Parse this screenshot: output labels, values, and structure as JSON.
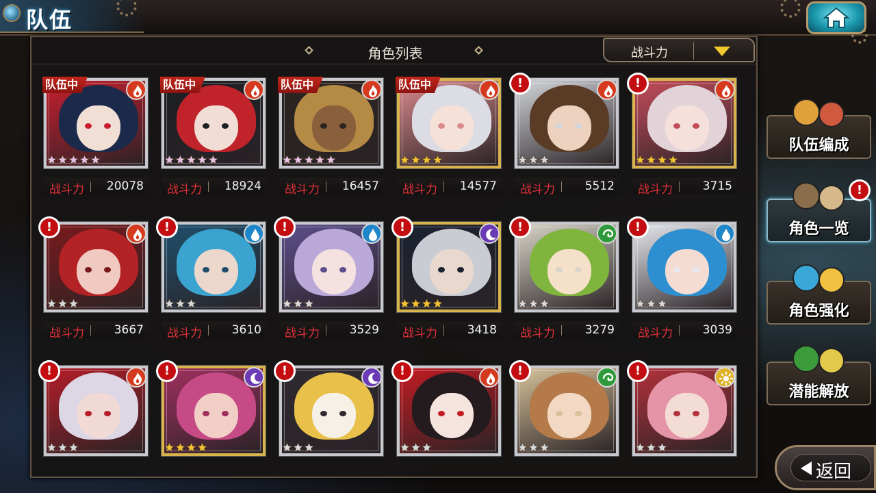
{
  "header": {
    "title": "队伍"
  },
  "panel": {
    "title": "角色列表",
    "sort": {
      "selected": "战斗力"
    },
    "power_label": "战斗力"
  },
  "colors": {
    "fire": "#d63a1e",
    "water": "#1f86c9",
    "dark": "#6b3bb5",
    "wind": "#2e9a3a",
    "light": "#e0b227",
    "badge_red": "#c2261b",
    "power_label": "#e0323a"
  },
  "cards": [
    {
      "badge": "队伍中",
      "element": "fire-icon",
      "rarity": 5,
      "power": "20078",
      "alert": false,
      "palette": [
        "#1b2a4a",
        "#f1dfd6",
        "#c81e2e"
      ]
    },
    {
      "badge": "队伍中",
      "element": "fire-icon",
      "rarity": 5,
      "power": "18924",
      "alert": false,
      "palette": [
        "#c0232a",
        "#f2ddd6",
        "#1c1f24"
      ]
    },
    {
      "badge": "队伍中",
      "element": "fire-icon",
      "rarity": 5,
      "power": "16457",
      "alert": false,
      "palette": [
        "#b58a45",
        "#8a5f3c",
        "#2b2420"
      ]
    },
    {
      "badge": "队伍中",
      "element": "fire-icon",
      "rarity": 4,
      "power": "14577",
      "alert": false,
      "palette": [
        "#dcdce4",
        "#f5e1d8",
        "#d98a8c"
      ]
    },
    {
      "badge": "",
      "element": "fire-icon",
      "rarity": 3,
      "power": "5512",
      "alert": true,
      "palette": [
        "#5a3b26",
        "#edd3bf",
        "#d2d5d9"
      ]
    },
    {
      "badge": "",
      "element": "fire-icon",
      "rarity": 4,
      "power": "3715",
      "alert": true,
      "palette": [
        "#e1d3d8",
        "#f6e0dc",
        "#c44d5b"
      ]
    },
    {
      "badge": "",
      "element": "fire-icon",
      "rarity": 3,
      "power": "3667",
      "alert": true,
      "palette": [
        "#b32225",
        "#f0c9c0",
        "#7a1a1c"
      ]
    },
    {
      "badge": "",
      "element": "water-icon",
      "rarity": 3,
      "power": "3610",
      "alert": true,
      "palette": [
        "#3aa3d0",
        "#ecd7cc",
        "#1f4f6c"
      ]
    },
    {
      "badge": "",
      "element": "water-icon",
      "rarity": 3,
      "power": "3529",
      "alert": true,
      "palette": [
        "#b9a8d8",
        "#f4e1e0",
        "#5d4f8c"
      ]
    },
    {
      "badge": "",
      "element": "dark-icon",
      "rarity": 4,
      "power": "3418",
      "alert": true,
      "palette": [
        "#c9ccd3",
        "#e8d8ce",
        "#1b2230"
      ]
    },
    {
      "badge": "",
      "element": "wind-icon",
      "rarity": 3,
      "power": "3279",
      "alert": true,
      "palette": [
        "#7fb53c",
        "#f5e0c9",
        "#d9d5c9"
      ]
    },
    {
      "badge": "",
      "element": "water-icon",
      "rarity": 3,
      "power": "3039",
      "alert": true,
      "palette": [
        "#2d8fd0",
        "#f4dcd3",
        "#e6e8ee"
      ]
    },
    {
      "badge": "",
      "element": "fire-icon",
      "rarity": 3,
      "power": "",
      "alert": true,
      "palette": [
        "#ddd6e4",
        "#f1dad6",
        "#b51d28"
      ]
    },
    {
      "badge": "",
      "element": "dark-icon",
      "rarity": 4,
      "power": "",
      "alert": true,
      "palette": [
        "#c64a86",
        "#f1cfc6",
        "#a0305e"
      ]
    },
    {
      "badge": "",
      "element": "dark-icon",
      "rarity": 3,
      "power": "",
      "alert": true,
      "palette": [
        "#e8c04a",
        "#f6f0e6",
        "#2e2a30"
      ]
    },
    {
      "badge": "",
      "element": "fire-icon",
      "rarity": 3,
      "power": "",
      "alert": true,
      "palette": [
        "#241b1f",
        "#f5e3de",
        "#c21b22"
      ]
    },
    {
      "badge": "",
      "element": "wind-icon",
      "rarity": 3,
      "power": "",
      "alert": true,
      "palette": [
        "#b47a4a",
        "#f3d9c4",
        "#d6c19a"
      ]
    },
    {
      "badge": "",
      "element": "light-icon",
      "rarity": 3,
      "power": "",
      "alert": true,
      "palette": [
        "#e593a6",
        "#f3dcd4",
        "#b2313b"
      ]
    }
  ],
  "side_menu": [
    {
      "label": "队伍编成",
      "alert": false,
      "active": false
    },
    {
      "label": "角色一览",
      "alert": true,
      "active": true
    },
    {
      "label": "角色强化",
      "alert": false,
      "active": false
    },
    {
      "label": "潜能解放",
      "alert": false,
      "active": false
    }
  ],
  "back": {
    "label": "返回"
  }
}
